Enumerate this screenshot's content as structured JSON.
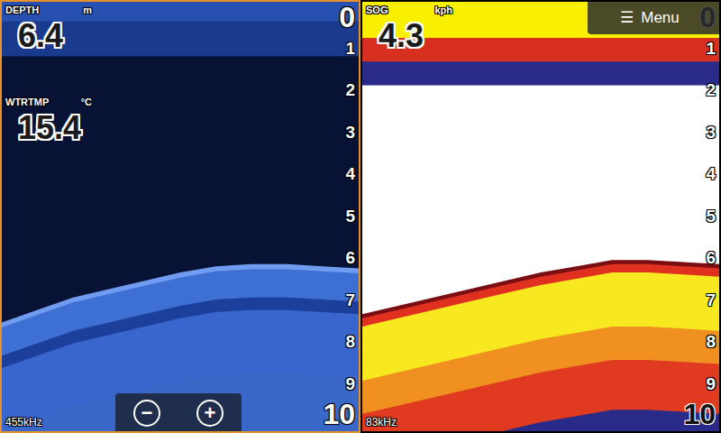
{
  "panes": [
    {
      "kind": "downscan",
      "selected": true,
      "frequency": "455kHz",
      "readouts": [
        {
          "label": "DEPTH",
          "unit": "m",
          "value": "6.4"
        },
        {
          "label": "WTRTMP",
          "unit": "°C",
          "value": "15.4"
        }
      ],
      "scale": [
        "0",
        "1",
        "2",
        "3",
        "4",
        "5",
        "6",
        "7",
        "8",
        "9",
        "10"
      ],
      "surface_clutter": 1.2,
      "bottom_profile": [
        7.6,
        7.3,
        7.0,
        6.8,
        6.6,
        6.4,
        6.25,
        6.2,
        6.2,
        6.25,
        6.3
      ],
      "zoom_buttons": [
        "−",
        "+"
      ]
    },
    {
      "kind": "broadband",
      "selected": false,
      "frequency": "83kHz",
      "readouts": [
        {
          "label": "SOG",
          "unit": "kph",
          "value": "4.3"
        }
      ],
      "scale": [
        "0",
        "1",
        "2",
        "3",
        "4",
        "5",
        "6",
        "7",
        "8",
        "9",
        "10"
      ],
      "surface_clutter": 1.9,
      "bottom_profile": [
        7.4,
        7.2,
        7.0,
        6.8,
        6.6,
        6.4,
        6.25,
        6.1,
        6.1,
        6.15,
        6.2
      ],
      "menu": {
        "icon": "☰",
        "label": "Menu"
      }
    }
  ]
}
